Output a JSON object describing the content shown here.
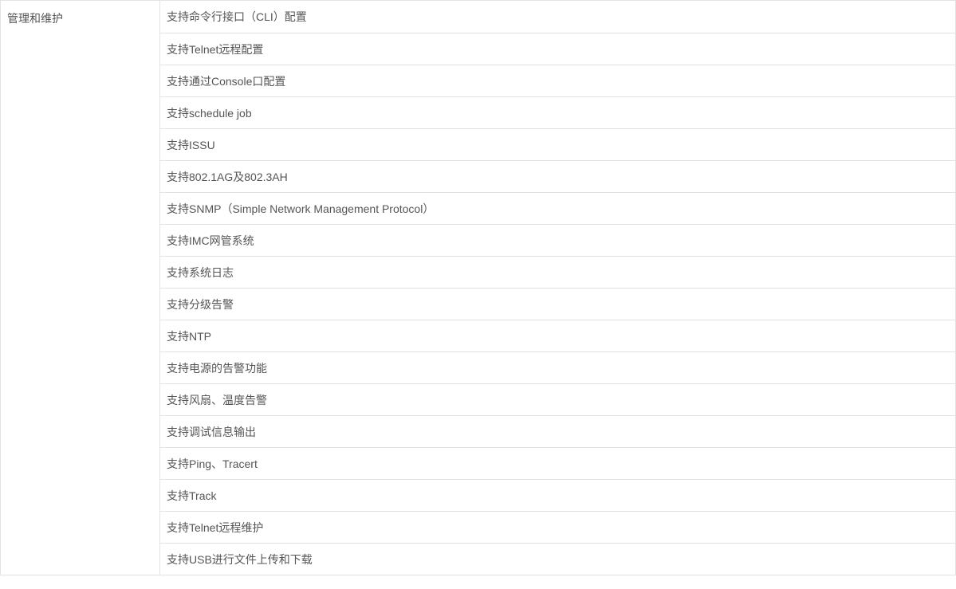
{
  "spec_table": {
    "category": "管理和维护",
    "features": [
      "支持命令行接口（CLI）配置",
      "支持Telnet远程配置",
      "支持通过Console口配置",
      "支持schedule job",
      "支持ISSU",
      "支持802.1AG及802.3AH",
      "支持SNMP（Simple Network Management Protocol）",
      "支持IMC网管系统",
      "支持系统日志",
      "支持分级告警",
      "支持NTP",
      "支持电源的告警功能",
      "支持风扇、温度告警",
      "支持调试信息输出",
      "支持Ping、Tracert",
      "支持Track",
      "支持Telnet远程维护",
      "支持USB进行文件上传和下载"
    ]
  }
}
